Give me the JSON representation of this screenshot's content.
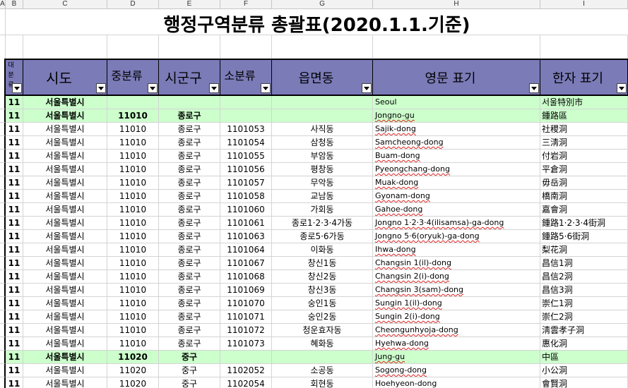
{
  "column_letters": [
    "A",
    "B",
    "C",
    "D",
    "E",
    "F",
    "G",
    "H",
    "I"
  ],
  "colors": {
    "header_bg": "#7b7bb8",
    "highlight_bg": "#ccffcc",
    "spellcheck_underline": "#e02020"
  },
  "sheet": {
    "title": "행정구역분류 총괄표(2020.1.1.기준)",
    "headers": {
      "major": "대분류",
      "sido": "시도",
      "middle": "중분류",
      "sigungu": "시군구",
      "minor": "소분류",
      "emd": "읍면동",
      "english": "영문 표기",
      "hanja": "한자 표기"
    },
    "rows": [
      {
        "major": "11",
        "sido": "서울특별시",
        "english": "Seoul",
        "hanja": "서울特別市",
        "highlighted": true
      },
      {
        "major": "11",
        "sido": "서울특별시",
        "middle": "11010",
        "sigungu": "종로구",
        "english": "Jongno-gu",
        "hanja": "鍾路區",
        "highlighted": true
      },
      {
        "major": "11",
        "sido": "서울특별시",
        "middle": "11010",
        "sigungu": "종로구",
        "minor": "1101053",
        "emd": "사직동",
        "english": "Sajik-dong",
        "hanja": "社稷洞"
      },
      {
        "major": "11",
        "sido": "서울특별시",
        "middle": "11010",
        "sigungu": "종로구",
        "minor": "1101054",
        "emd": "삼청동",
        "english": "Samcheong-dong",
        "hanja": "三淸洞"
      },
      {
        "major": "11",
        "sido": "서울특별시",
        "middle": "11010",
        "sigungu": "종로구",
        "minor": "1101055",
        "emd": "부암동",
        "english": "Buam-dong",
        "hanja": "付岩洞"
      },
      {
        "major": "11",
        "sido": "서울특별시",
        "middle": "11010",
        "sigungu": "종로구",
        "minor": "1101056",
        "emd": "평창동",
        "english": "Pyeongchang-dong",
        "hanja": "平倉洞"
      },
      {
        "major": "11",
        "sido": "서울특별시",
        "middle": "11010",
        "sigungu": "종로구",
        "minor": "1101057",
        "emd": "무악동",
        "english": "Muak-dong",
        "hanja": "毋岳洞"
      },
      {
        "major": "11",
        "sido": "서울특별시",
        "middle": "11010",
        "sigungu": "종로구",
        "minor": "1101058",
        "emd": "교남동",
        "english": "Gyonam-dong",
        "hanja": "橋南洞"
      },
      {
        "major": "11",
        "sido": "서울특별시",
        "middle": "11010",
        "sigungu": "종로구",
        "minor": "1101060",
        "emd": "가회동",
        "english": "Gahoe-dong",
        "hanja": "嘉會洞"
      },
      {
        "major": "11",
        "sido": "서울특별시",
        "middle": "11010",
        "sigungu": "종로구",
        "minor": "1101061",
        "emd": "종로1·2·3·4가동",
        "english": "Jongno 1·2·3·4(ilisamsa)-ga-dong",
        "hanja": "鍾路1·2·3·4街洞"
      },
      {
        "major": "11",
        "sido": "서울특별시",
        "middle": "11010",
        "sigungu": "종로구",
        "minor": "1101063",
        "emd": "종로5·6가동",
        "english": "Jongno 5·6(oryuk)-ga-dong",
        "hanja": "鍾路5·6街洞"
      },
      {
        "major": "11",
        "sido": "서울특별시",
        "middle": "11010",
        "sigungu": "종로구",
        "minor": "1101064",
        "emd": "이화동",
        "english": "Ihwa-dong",
        "hanja": "梨花洞"
      },
      {
        "major": "11",
        "sido": "서울특별시",
        "middle": "11010",
        "sigungu": "종로구",
        "minor": "1101067",
        "emd": "창신1동",
        "english": "Changsin 1(il)-dong",
        "hanja": "昌信1洞"
      },
      {
        "major": "11",
        "sido": "서울특별시",
        "middle": "11010",
        "sigungu": "종로구",
        "minor": "1101068",
        "emd": "창신2동",
        "english": "Changsin 2(i)-dong",
        "hanja": "昌信2洞"
      },
      {
        "major": "11",
        "sido": "서울특별시",
        "middle": "11010",
        "sigungu": "종로구",
        "minor": "1101069",
        "emd": "창신3동",
        "english": "Changsin 3(sam)-dong",
        "hanja": "昌信3洞"
      },
      {
        "major": "11",
        "sido": "서울특별시",
        "middle": "11010",
        "sigungu": "종로구",
        "minor": "1101070",
        "emd": "숭인1동",
        "english": "Sungin 1(il)-dong",
        "hanja": "崇仁1洞"
      },
      {
        "major": "11",
        "sido": "서울특별시",
        "middle": "11010",
        "sigungu": "종로구",
        "minor": "1101071",
        "emd": "숭인2동",
        "english": "Sungin 2(i)-dong",
        "hanja": "崇仁2洞"
      },
      {
        "major": "11",
        "sido": "서울특별시",
        "middle": "11010",
        "sigungu": "종로구",
        "minor": "1101072",
        "emd": "청운효자동",
        "english": "Cheongunhyoja-dong",
        "hanja": "淸雲孝子洞"
      },
      {
        "major": "11",
        "sido": "서울특별시",
        "middle": "11010",
        "sigungu": "종로구",
        "minor": "1101073",
        "emd": "혜화동",
        "english": "Hyehwa-dong",
        "hanja": "惠化洞"
      },
      {
        "major": "11",
        "sido": "서울특별시",
        "middle": "11020",
        "sigungu": "중구",
        "english": "Jung-gu",
        "hanja": "中區",
        "highlighted": true
      },
      {
        "major": "11",
        "sido": "서울특별시",
        "middle": "11020",
        "sigungu": "중구",
        "minor": "1102052",
        "emd": "소공동",
        "english": "Sogong-dong",
        "hanja": "小公洞"
      },
      {
        "major": "11",
        "sido": "서울특별시",
        "middle": "11020",
        "sigungu": "중구",
        "minor": "1102054",
        "emd": "회현동",
        "english": "Hoehyeon-dong",
        "hanja": "會賢洞"
      }
    ]
  }
}
